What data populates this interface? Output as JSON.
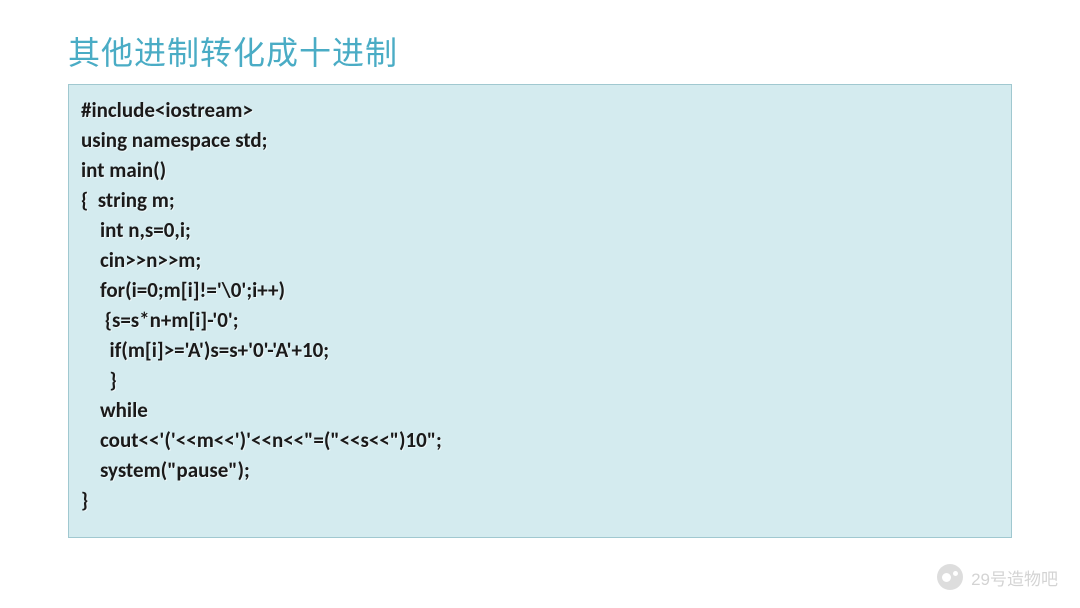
{
  "heading": "其他进制转化成十进制",
  "code": {
    "l0": "#include<iostream>",
    "l1": "using namespace std;",
    "l2": "int main()",
    "l3": "{  string m;",
    "l4": "    int n,s=0,i;",
    "l5": "    cin>>n>>m;",
    "l6": "    for(i=0;m[i]!='\\0';i++)",
    "l7": "     {s=s*n+m[i]-'0';",
    "l8": "      if(m[i]>='A')s=s+'0'-'A'+10;",
    "l9": "      }",
    "l10": "    while",
    "l11": "    cout<<'('<<m<<')'<<n<<\"=(\"<<s<<\")10\";",
    "l12": "    system(\"pause\");",
    "l13": "}"
  },
  "watermark": "29号造物吧"
}
